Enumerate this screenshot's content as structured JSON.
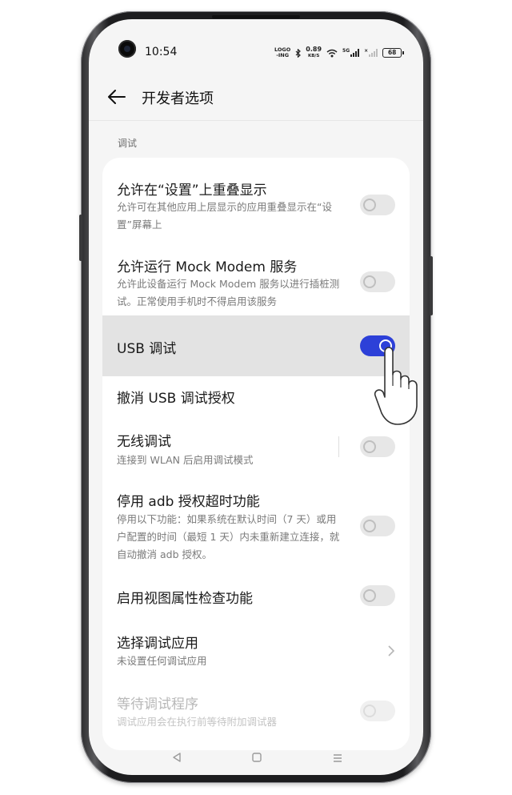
{
  "status_bar": {
    "time": "10:54",
    "logo_ing": "LOGO\n-ING",
    "net_speed_value": "0.89",
    "net_speed_unit": "KB/S",
    "network": "5G",
    "battery": "68"
  },
  "header": {
    "title": "开发者选项",
    "back_icon": "arrow-left-icon"
  },
  "section": {
    "label": "调试"
  },
  "settings": [
    {
      "title": "允许在“设置”上重叠显示",
      "desc": "允许可在其他应用上层显示的应用重叠显示在“设置”屏幕上",
      "control": "toggle",
      "state": "off"
    },
    {
      "title": "允许运行 Mock Modem 服务",
      "desc": "允许此设备运行 Mock Modem 服务以进行插桩测试。正常使用手机时不得启用该服务",
      "control": "toggle",
      "state": "off"
    },
    {
      "title": "USB 调试",
      "desc": "",
      "control": "toggle",
      "state": "on",
      "highlighted": true
    },
    {
      "title": "撤消 USB 调试授权",
      "desc": "",
      "control": "chevron"
    },
    {
      "title": "无线调试",
      "desc": "连接到 WLAN 后启用调试模式",
      "control": "toggle",
      "state": "off"
    },
    {
      "title": "停用 adb 授权超时功能",
      "desc": "停用以下功能：如果系统在默认时间（7 天）或用户配置的时间（最短 1 天）内未重新建立连接，就自动撤消 adb 授权。",
      "control": "toggle",
      "state": "off"
    },
    {
      "title": "启用视图属性检查功能",
      "desc": "",
      "control": "toggle",
      "state": "off"
    },
    {
      "title": "选择调试应用",
      "desc": "未设置任何调试应用",
      "control": "chevron"
    },
    {
      "title": "等待调试程序",
      "desc": "调试应用会在执行前等待附加调试器",
      "control": "toggle",
      "state": "off",
      "disabled": true
    }
  ],
  "nav_icons": [
    "back-triangle-icon",
    "home-square-icon",
    "menu-lines-icon"
  ],
  "colors": {
    "accent": "#2d40d8",
    "screen_bg": "#f5f5f5",
    "highlight_row": "#e3e3e3"
  }
}
